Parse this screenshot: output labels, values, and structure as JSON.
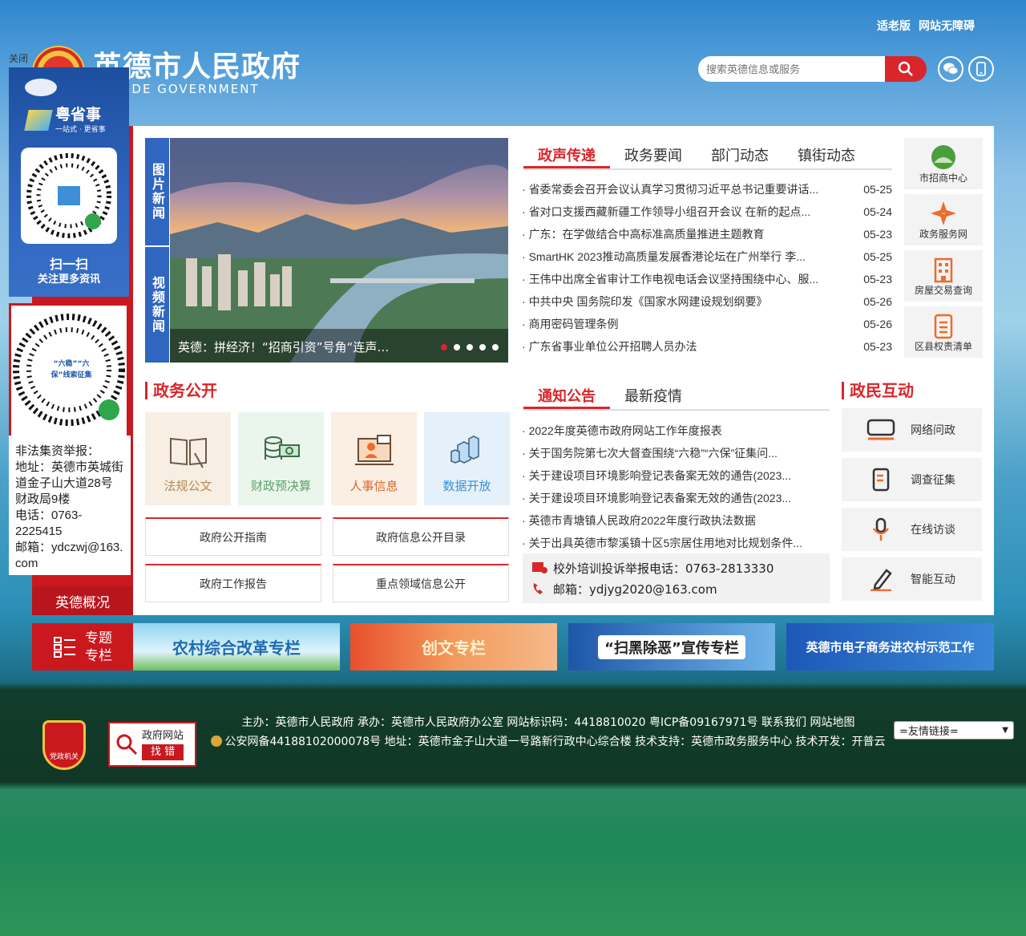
{
  "header": {
    "top_links": [
      "适老版",
      "网站无障碍"
    ],
    "site_title": "英德市人民政府",
    "site_title_en": "YINGDE GOVERNMENT",
    "search_placeholder": "搜索英德信息或服务"
  },
  "float_ad": {
    "close": "关闭",
    "app_name": "粤省事",
    "app_slogan": "一站式 · 更省事",
    "scan_title": "扫一扫",
    "scan_sub": "关注更多资讯",
    "qr2_label": "“六稳”“六保”线索征集",
    "report_title": "非法集资举报：",
    "report_address": "地址：英德市英城街道金子山大道28号财政局9楼",
    "report_phone": "电话：0763-2225415",
    "report_email": "邮箱：ydczwj@163.com"
  },
  "left_nav": {
    "overview": "英德概况"
  },
  "news": {
    "vertical_tabs": [
      "图片新闻",
      "视频新闻"
    ],
    "caption": "英德：拼经济！“招商引资”号角“连声…",
    "tabs": [
      "政声传递",
      "政务要闻",
      "部门动态",
      "镇街动态"
    ],
    "items": [
      {
        "title": "省委常委会召开会议认真学习贯彻习近平总书记重要讲话...",
        "date": "05-25"
      },
      {
        "title": "省对口支援西藏新疆工作领导小组召开会议 在新的起点...",
        "date": "05-24"
      },
      {
        "title": "广东：在学做结合中高标准高质量推进主题教育",
        "date": "05-23"
      },
      {
        "title": "SmartHK 2023推动高质量发展香港论坛在广州举行 李...",
        "date": "05-25"
      },
      {
        "title": "王伟中出席全省审计工作电视电话会议坚持围绕中心、服...",
        "date": "05-23"
      },
      {
        "title": "中共中央 国务院印发《国家水网建设规划纲要》",
        "date": "05-26"
      },
      {
        "title": "商用密码管理条例",
        "date": "05-26"
      },
      {
        "title": "广东省事业单位公开招聘人员办法",
        "date": "05-23"
      }
    ]
  },
  "side_services": [
    "市招商中心",
    "政务服务网",
    "房屋交易查询",
    "区县权责清单"
  ],
  "gov_open": {
    "title": "政务公开",
    "tiles": [
      "法规公文",
      "财政预决算",
      "人事信息",
      "数据开放"
    ],
    "links": [
      "政府公开指南",
      "政府信息公开目录",
      "政府工作报告",
      "重点领域信息公开"
    ]
  },
  "notice": {
    "tabs": [
      "通知公告",
      "最新疫情"
    ],
    "items": [
      "2022年度英德市政府网站工作年度报表",
      "关于国务院第七次大督查围绕“六稳”“六保”征集问...",
      "关于建设项目环境影响登记表备案无效的通告(2023...",
      "关于建设项目环境影响登记表备案无效的通告(2023...",
      "英德市青塘镇人民政府2022年度行政执法数据",
      "关于出具英德市黎溪镇十区5宗居住用地对比规划条件..."
    ],
    "hotline": "校外培训投诉举报电话：0763-2813330",
    "email": "邮箱：ydjyg2020@163.com"
  },
  "interaction": {
    "title": "政民互动",
    "items": [
      "网络问政",
      "调查征集",
      "在线访谈",
      "智能互动"
    ]
  },
  "banners": {
    "special_label": [
      "专题",
      "专栏"
    ],
    "items": [
      "农村综合改革专栏",
      "创文专栏",
      "“扫黑除恶”宣传专栏",
      "英德市电子商务进农村示范工作"
    ]
  },
  "footer": {
    "line1": "主办：英德市人民政府  承办：英德市人民政府办公室  网站标识码：4418810020  粤ICP备09167971号  联系我们  网站地图",
    "line2": "公安网备44188102000078号  地址：英德市金子山大道一号路新行政中心综合楼  技术支持：英德市政务服务中心  技术开发：开普云",
    "badge1": "党政机关",
    "badge2_top": "政府网站",
    "badge2_bottom": "找 错",
    "friend_links": "=友情链接="
  },
  "colors": {
    "accent": "#d9262b",
    "brand_blue": "#2f66c0"
  }
}
